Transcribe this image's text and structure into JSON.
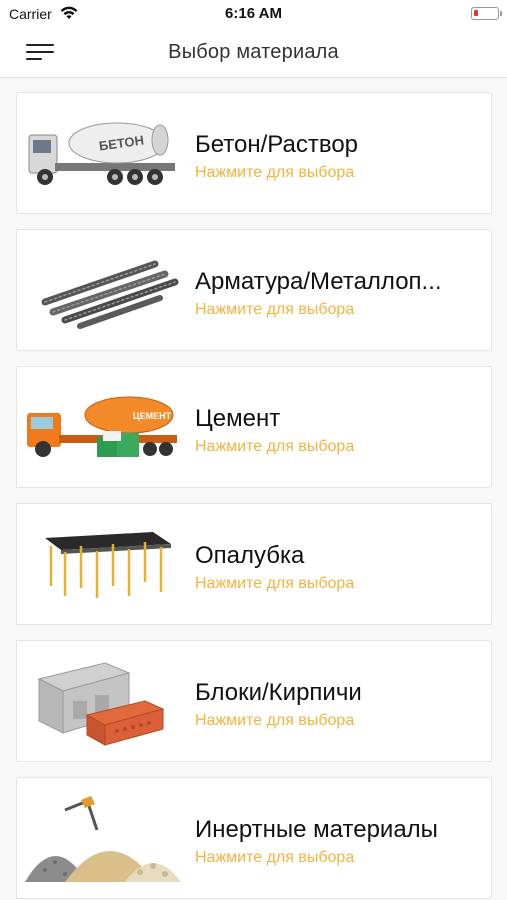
{
  "status": {
    "carrier": "Carrier",
    "time": "6:16 AM"
  },
  "nav": {
    "title": "Выбор материала"
  },
  "materials": [
    {
      "title": "Бетон/Раствор",
      "subtitle": "Нажмите для выбора",
      "truck_text": "БЕТОН"
    },
    {
      "title": "Арматура/Металлоп...",
      "subtitle": "Нажмите для выбора"
    },
    {
      "title": "Цемент",
      "subtitle": "Нажмите для выбора",
      "truck_text": "ЦЕМЕНТ"
    },
    {
      "title": "Опалубка",
      "subtitle": "Нажмите для выбора"
    },
    {
      "title": "Блоки/Кирпичи",
      "subtitle": "Нажмите для выбора"
    },
    {
      "title": "Инертные материалы",
      "subtitle": "Нажмите для выбора"
    }
  ],
  "colors": {
    "accent": "#f3b33d",
    "battery_low": "#e33333"
  }
}
